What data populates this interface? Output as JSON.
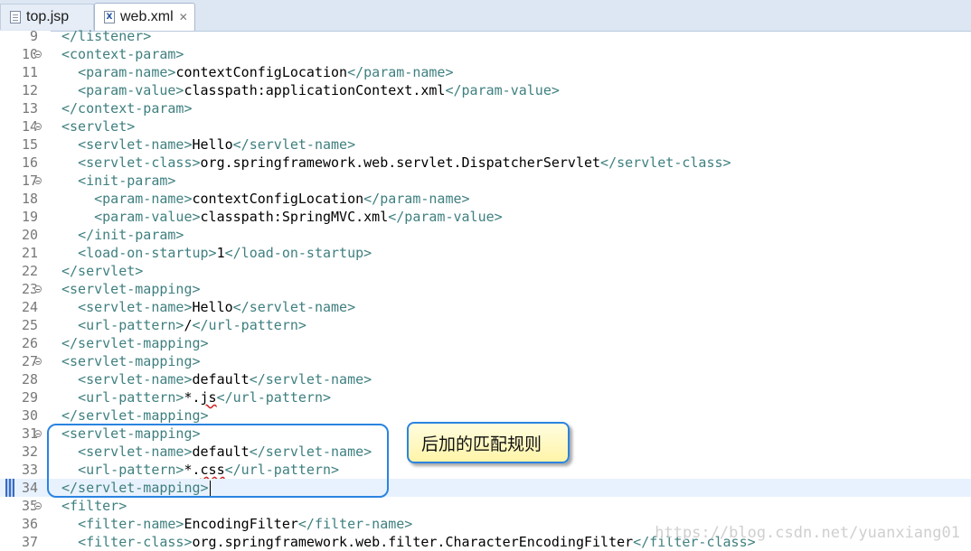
{
  "tabs": [
    {
      "label": "top.jsp",
      "icon": "jsp-file-icon",
      "active": false
    },
    {
      "label": "web.xml",
      "icon": "xml-file-icon",
      "active": true,
      "close": "✕"
    }
  ],
  "editor": {
    "current_line": "34",
    "lines": [
      {
        "n": "9",
        "fold": false,
        "segs": [
          [
            "t",
            "</listener>"
          ]
        ]
      },
      {
        "n": "10",
        "fold": true,
        "segs": [
          [
            "t",
            "<context-param>"
          ]
        ]
      },
      {
        "n": "11",
        "fold": false,
        "segs": [
          [
            "i",
            "  "
          ],
          [
            "t",
            "<param-name>"
          ],
          [
            "x",
            "contextConfigLocation"
          ],
          [
            "t",
            "</param-name>"
          ]
        ]
      },
      {
        "n": "12",
        "fold": false,
        "segs": [
          [
            "i",
            "  "
          ],
          [
            "t",
            "<param-value>"
          ],
          [
            "x",
            "classpath:applicationContext.xml"
          ],
          [
            "t",
            "</param-value>"
          ]
        ]
      },
      {
        "n": "13",
        "fold": false,
        "segs": [
          [
            "t",
            "</context-param>"
          ]
        ]
      },
      {
        "n": "14",
        "fold": true,
        "segs": [
          [
            "t",
            "<servlet>"
          ]
        ]
      },
      {
        "n": "15",
        "fold": false,
        "segs": [
          [
            "i",
            "  "
          ],
          [
            "t",
            "<servlet-name>"
          ],
          [
            "x",
            "Hello"
          ],
          [
            "t",
            "</servlet-name>"
          ]
        ]
      },
      {
        "n": "16",
        "fold": false,
        "segs": [
          [
            "i",
            "  "
          ],
          [
            "t",
            "<servlet-class>"
          ],
          [
            "x",
            "org.springframework.web.servlet.DispatcherServlet"
          ],
          [
            "t",
            "</servlet-class>"
          ]
        ]
      },
      {
        "n": "17",
        "fold": true,
        "segs": [
          [
            "i",
            "  "
          ],
          [
            "t",
            "<init-param>"
          ]
        ]
      },
      {
        "n": "18",
        "fold": false,
        "segs": [
          [
            "i",
            "    "
          ],
          [
            "t",
            "<param-name>"
          ],
          [
            "x",
            "contextConfigLocation"
          ],
          [
            "t",
            "</param-name>"
          ]
        ]
      },
      {
        "n": "19",
        "fold": false,
        "segs": [
          [
            "i",
            "    "
          ],
          [
            "t",
            "<param-value>"
          ],
          [
            "x",
            "classpath:SpringMVC.xml"
          ],
          [
            "t",
            "</param-value>"
          ]
        ]
      },
      {
        "n": "20",
        "fold": false,
        "segs": [
          [
            "i",
            "  "
          ],
          [
            "t",
            "</init-param>"
          ]
        ]
      },
      {
        "n": "21",
        "fold": false,
        "segs": [
          [
            "i",
            "  "
          ],
          [
            "t",
            "<load-on-startup>"
          ],
          [
            "x",
            "1"
          ],
          [
            "t",
            "</load-on-startup>"
          ]
        ]
      },
      {
        "n": "22",
        "fold": false,
        "segs": [
          [
            "t",
            "</servlet>"
          ]
        ]
      },
      {
        "n": "23",
        "fold": true,
        "segs": [
          [
            "t",
            "<servlet-mapping>"
          ]
        ]
      },
      {
        "n": "24",
        "fold": false,
        "segs": [
          [
            "i",
            "  "
          ],
          [
            "t",
            "<servlet-name>"
          ],
          [
            "x",
            "Hello"
          ],
          [
            "t",
            "</servlet-name>"
          ]
        ]
      },
      {
        "n": "25",
        "fold": false,
        "segs": [
          [
            "i",
            "  "
          ],
          [
            "t",
            "<url-pattern>"
          ],
          [
            "x",
            "/"
          ],
          [
            "t",
            "</url-pattern>"
          ]
        ]
      },
      {
        "n": "26",
        "fold": false,
        "segs": [
          [
            "t",
            "</servlet-mapping>"
          ]
        ]
      },
      {
        "n": "27",
        "fold": true,
        "segs": [
          [
            "t",
            "<servlet-mapping>"
          ]
        ]
      },
      {
        "n": "28",
        "fold": false,
        "segs": [
          [
            "i",
            "  "
          ],
          [
            "t",
            "<servlet-name>"
          ],
          [
            "x",
            "default"
          ],
          [
            "t",
            "</servlet-name>"
          ]
        ]
      },
      {
        "n": "29",
        "fold": false,
        "segs": [
          [
            "i",
            "  "
          ],
          [
            "t",
            "<url-pattern>"
          ],
          [
            "x",
            "*."
          ],
          [
            "s",
            "js"
          ],
          [
            "t",
            "</url-pattern>"
          ]
        ]
      },
      {
        "n": "30",
        "fold": false,
        "segs": [
          [
            "t",
            "</servlet-mapping>"
          ]
        ]
      },
      {
        "n": "31",
        "fold": true,
        "segs": [
          [
            "t",
            "<servlet-mapping>"
          ]
        ]
      },
      {
        "n": "32",
        "fold": false,
        "segs": [
          [
            "i",
            "  "
          ],
          [
            "t",
            "<servlet-name>"
          ],
          [
            "x",
            "default"
          ],
          [
            "t",
            "</servlet-name>"
          ]
        ]
      },
      {
        "n": "33",
        "fold": false,
        "segs": [
          [
            "i",
            "  "
          ],
          [
            "t",
            "<url-pattern>"
          ],
          [
            "x",
            "*."
          ],
          [
            "s",
            "css"
          ],
          [
            "t",
            "</url-pattern>"
          ]
        ]
      },
      {
        "n": "34",
        "fold": false,
        "segs": [
          [
            "t",
            "</servlet-mapping>"
          ]
        ]
      },
      {
        "n": "35",
        "fold": true,
        "segs": [
          [
            "t",
            "<filter>"
          ]
        ]
      },
      {
        "n": "36",
        "fold": false,
        "segs": [
          [
            "i",
            "  "
          ],
          [
            "t",
            "<filter-name>"
          ],
          [
            "x",
            "EncodingFilter"
          ],
          [
            "t",
            "</filter-name>"
          ]
        ]
      },
      {
        "n": "37",
        "fold": false,
        "segs": [
          [
            "i",
            "  "
          ],
          [
            "t",
            "<filter-class>"
          ],
          [
            "x",
            "org.springframework.web.filter.CharacterEncodingFilter"
          ],
          [
            "t",
            "</filter-class>"
          ]
        ]
      }
    ]
  },
  "annotation": {
    "label": "后加的匹配规则"
  },
  "watermark": "https://blog.csdn.net/yuanxiang01",
  "colors": {
    "tag": "#3f7f7f",
    "text": "#000000",
    "line_number": "#787878",
    "highlight_border": "#2a84e0",
    "callout_fill": "#fff4a8"
  }
}
